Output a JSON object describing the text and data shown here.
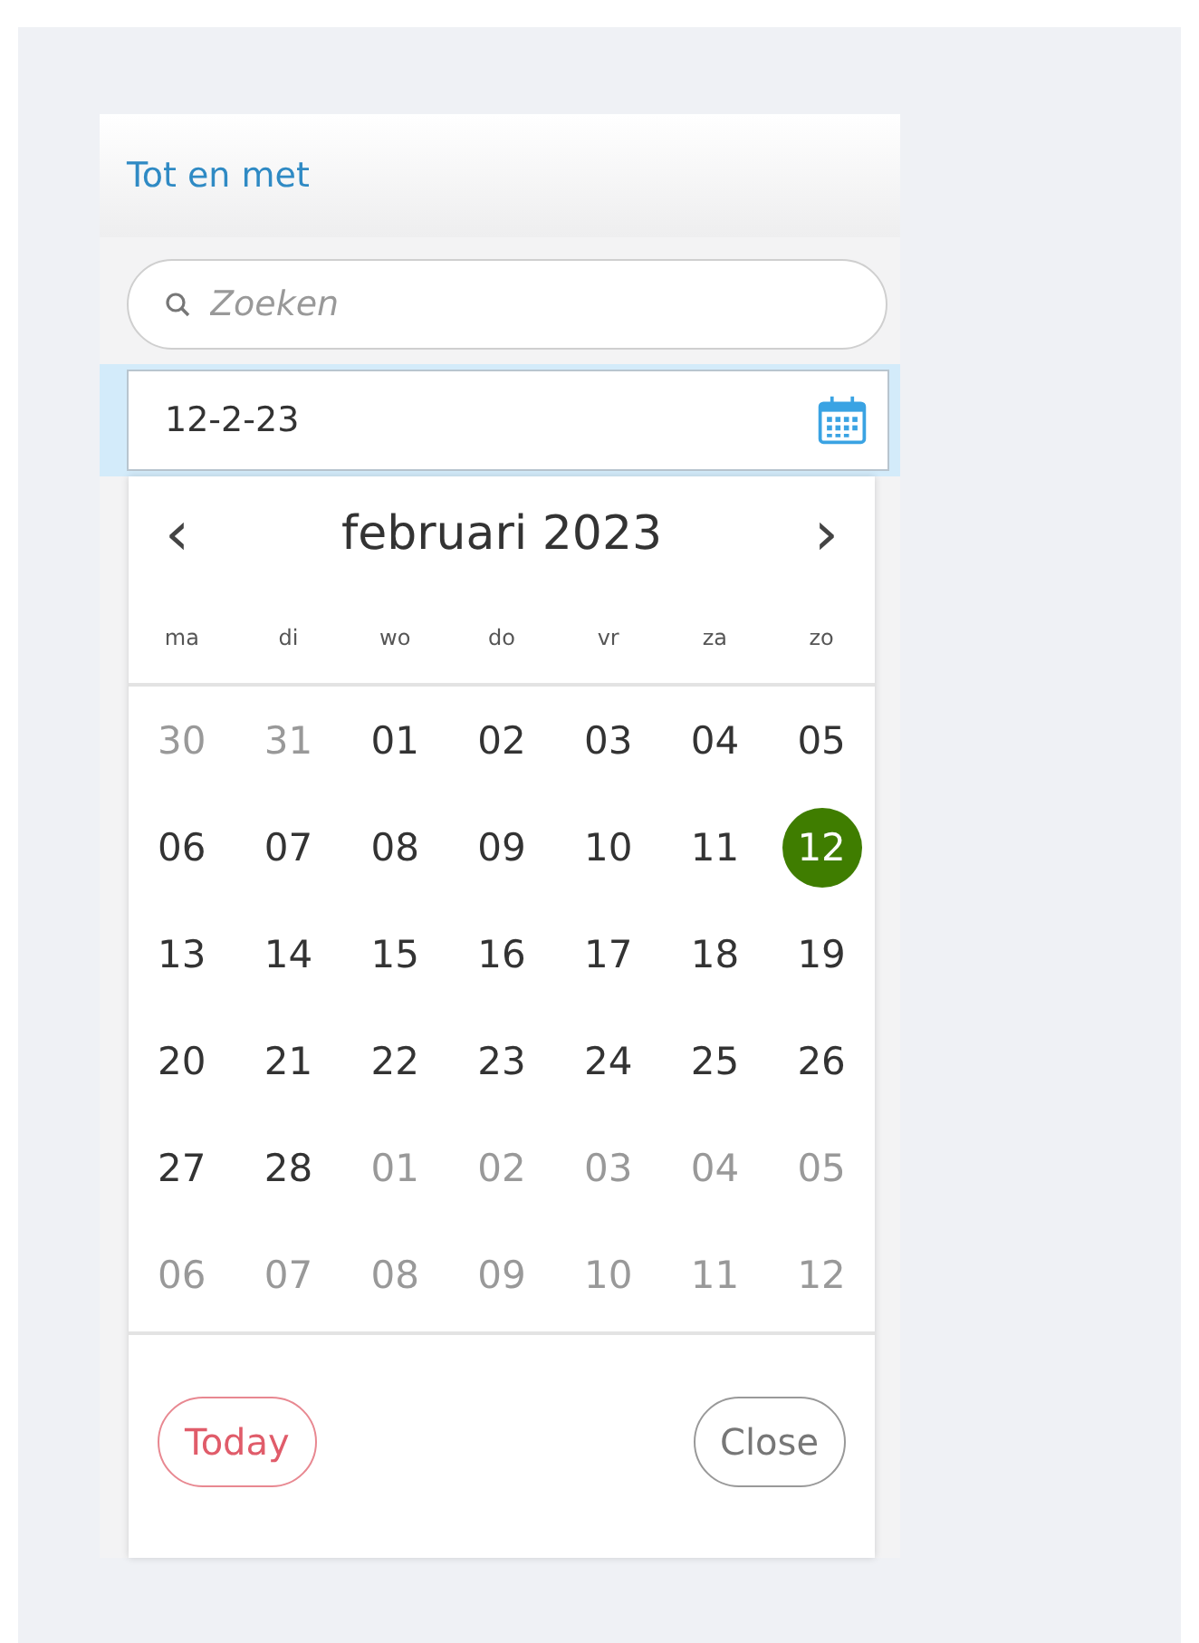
{
  "header": {
    "title": "Tot en met"
  },
  "search": {
    "placeholder": "Zoeken"
  },
  "date_field": {
    "value": "12-2-23"
  },
  "calendar": {
    "prev": "‹",
    "month": "februari 2023",
    "next": "›",
    "weekdays": [
      "ma",
      "di",
      "wo",
      "do",
      "vr",
      "za",
      "zo"
    ],
    "days": [
      {
        "label": "30",
        "muted": true,
        "selected": false
      },
      {
        "label": "31",
        "muted": true,
        "selected": false
      },
      {
        "label": "01",
        "muted": false,
        "selected": false
      },
      {
        "label": "02",
        "muted": false,
        "selected": false
      },
      {
        "label": "03",
        "muted": false,
        "selected": false
      },
      {
        "label": "04",
        "muted": false,
        "selected": false
      },
      {
        "label": "05",
        "muted": false,
        "selected": false
      },
      {
        "label": "06",
        "muted": false,
        "selected": false
      },
      {
        "label": "07",
        "muted": false,
        "selected": false
      },
      {
        "label": "08",
        "muted": false,
        "selected": false
      },
      {
        "label": "09",
        "muted": false,
        "selected": false
      },
      {
        "label": "10",
        "muted": false,
        "selected": false
      },
      {
        "label": "11",
        "muted": false,
        "selected": false
      },
      {
        "label": "12",
        "muted": false,
        "selected": true
      },
      {
        "label": "13",
        "muted": false,
        "selected": false
      },
      {
        "label": "14",
        "muted": false,
        "selected": false
      },
      {
        "label": "15",
        "muted": false,
        "selected": false
      },
      {
        "label": "16",
        "muted": false,
        "selected": false
      },
      {
        "label": "17",
        "muted": false,
        "selected": false
      },
      {
        "label": "18",
        "muted": false,
        "selected": false
      },
      {
        "label": "19",
        "muted": false,
        "selected": false
      },
      {
        "label": "20",
        "muted": false,
        "selected": false
      },
      {
        "label": "21",
        "muted": false,
        "selected": false
      },
      {
        "label": "22",
        "muted": false,
        "selected": false
      },
      {
        "label": "23",
        "muted": false,
        "selected": false
      },
      {
        "label": "24",
        "muted": false,
        "selected": false
      },
      {
        "label": "25",
        "muted": false,
        "selected": false
      },
      {
        "label": "26",
        "muted": false,
        "selected": false
      },
      {
        "label": "27",
        "muted": false,
        "selected": false
      },
      {
        "label": "28",
        "muted": false,
        "selected": false
      },
      {
        "label": "01",
        "muted": true,
        "selected": false
      },
      {
        "label": "02",
        "muted": true,
        "selected": false
      },
      {
        "label": "03",
        "muted": true,
        "selected": false
      },
      {
        "label": "04",
        "muted": true,
        "selected": false
      },
      {
        "label": "05",
        "muted": true,
        "selected": false
      },
      {
        "label": "06",
        "muted": true,
        "selected": false
      },
      {
        "label": "07",
        "muted": true,
        "selected": false
      },
      {
        "label": "08",
        "muted": true,
        "selected": false
      },
      {
        "label": "09",
        "muted": true,
        "selected": false
      },
      {
        "label": "10",
        "muted": true,
        "selected": false
      },
      {
        "label": "11",
        "muted": true,
        "selected": false
      },
      {
        "label": "12",
        "muted": true,
        "selected": false
      }
    ],
    "buttons": [
      {
        "label": "Today",
        "kind": "today"
      },
      {
        "label": "Close",
        "kind": "close"
      }
    ]
  }
}
